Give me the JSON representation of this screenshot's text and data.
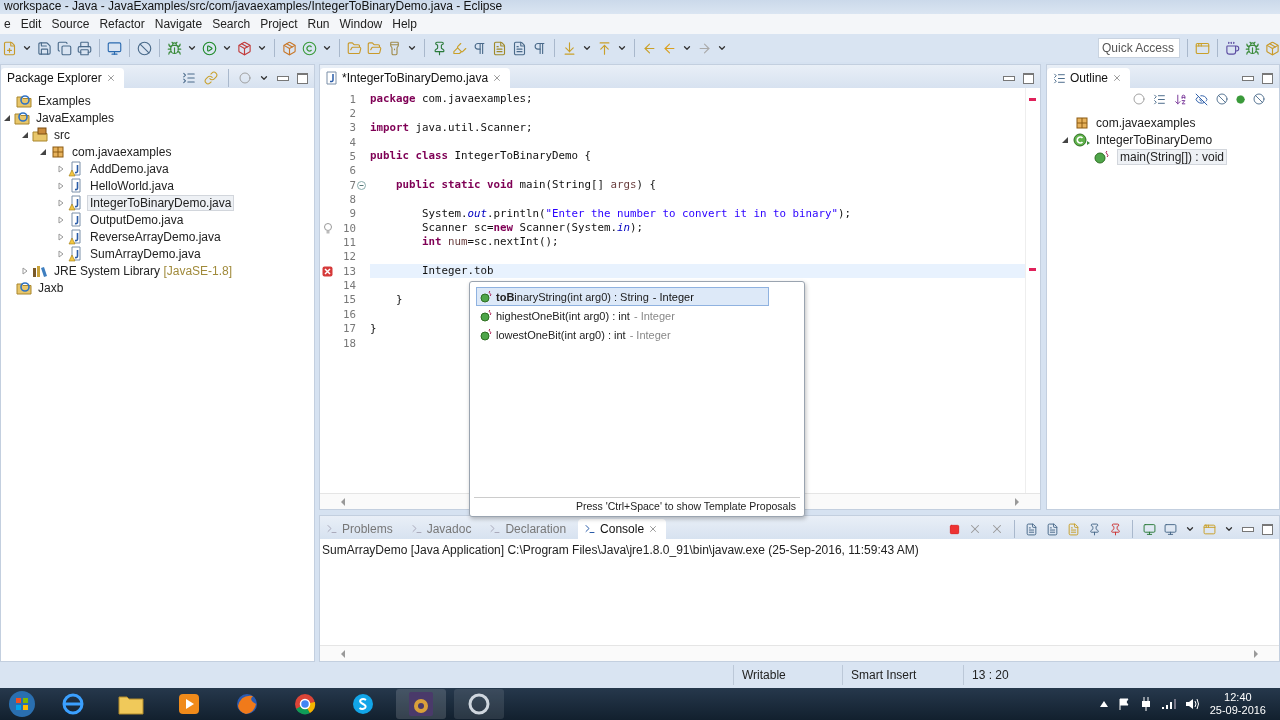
{
  "window": {
    "title": "workspace - Java - JavaExamples/src/com/javaexamples/IntegerToBinaryDemo.java - Eclipse"
  },
  "menu": [
    "e",
    "Edit",
    "Source",
    "Refactor",
    "Navigate",
    "Search",
    "Project",
    "Run",
    "Window",
    "Help"
  ],
  "quick_access": {
    "placeholder": "Quick Access"
  },
  "package_explorer": {
    "title": "Package Explorer",
    "tree": [
      {
        "kind": "project",
        "label": "Examples",
        "selected": false
      },
      {
        "kind": "project",
        "label": "JavaExamples",
        "selected": false,
        "expanded": true,
        "children": [
          {
            "kind": "source",
            "label": "src",
            "selected": false,
            "expanded": true,
            "children": [
              {
                "kind": "package",
                "label": "com.javaexamples",
                "selected": false,
                "expanded": true,
                "children": [
                  {
                    "kind": "java",
                    "label": "AddDemo.java",
                    "selected": false,
                    "expanded": false,
                    "warning": true
                  },
                  {
                    "kind": "java",
                    "label": "HelloWorld.java",
                    "selected": false,
                    "expanded": false,
                    "warning": false
                  },
                  {
                    "kind": "java",
                    "label": "IntegerToBinaryDemo.java",
                    "selected": true,
                    "expanded": false,
                    "warning": true
                  },
                  {
                    "kind": "java",
                    "label": "OutputDemo.java",
                    "selected": false,
                    "expanded": false,
                    "warning": false
                  },
                  {
                    "kind": "java",
                    "label": "ReverseArrayDemo.java",
                    "selected": false,
                    "expanded": false,
                    "warning": true
                  },
                  {
                    "kind": "java",
                    "label": "SumArrayDemo.java",
                    "selected": false,
                    "expanded": false,
                    "warning": true
                  }
                ]
              }
            ]
          },
          {
            "kind": "library",
            "label": "JRE System Library",
            "decoration": "[JavaSE-1.8]",
            "selected": false,
            "expanded": false
          }
        ]
      },
      {
        "kind": "project",
        "label": "Jaxb",
        "selected": false
      }
    ]
  },
  "editor": {
    "tab": {
      "label": "*IntegerToBinaryDemo.java",
      "selected": true
    },
    "lines": [
      {
        "number": "1",
        "kind": "plain",
        "current": false,
        "segments": [
          {
            "kind": "kw",
            "text": "package"
          },
          {
            "kind": "plain",
            "text": " com.javaexamples;"
          }
        ]
      },
      {
        "number": "2",
        "kind": "plain",
        "current": false
      },
      {
        "number": "3",
        "kind": "plain",
        "current": false,
        "segments": [
          {
            "kind": "kw",
            "text": "import"
          },
          {
            "kind": "plain",
            "text": " java.util.Scanner;"
          }
        ]
      },
      {
        "number": "4",
        "kind": "plain",
        "current": false
      },
      {
        "number": "5",
        "kind": "plain",
        "current": false,
        "segments": [
          {
            "kind": "kw",
            "text": "public class"
          },
          {
            "kind": "plain",
            "text": " IntegerToBinaryDemo {"
          }
        ]
      },
      {
        "number": "6",
        "kind": "plain",
        "current": false
      },
      {
        "number": "7",
        "kind": "fold",
        "current": false,
        "segments": [
          {
            "kind": "kw",
            "text": "    public static void"
          },
          {
            "kind": "plain",
            "text": " main(String[] "
          },
          {
            "kind": "local",
            "text": "args"
          },
          {
            "kind": "plain",
            "text": ") {"
          }
        ]
      },
      {
        "number": "8",
        "kind": "plain",
        "current": false
      },
      {
        "number": "9",
        "kind": "plain",
        "current": false,
        "segments": [
          {
            "kind": "plain",
            "text": "        System."
          },
          {
            "kind": "field",
            "text": "out"
          },
          {
            "kind": "plain",
            "text": ".println("
          },
          {
            "kind": "str",
            "text": "\"Enter the number to convert it in to binary\""
          },
          {
            "kind": "plain",
            "text": ");"
          }
        ]
      },
      {
        "number": "10",
        "kind": "warning",
        "current": false,
        "segments": [
          {
            "kind": "plain",
            "text": "        Scanner sc="
          },
          {
            "kind": "kw",
            "text": "new"
          },
          {
            "kind": "plain",
            "text": " Scanner(System."
          },
          {
            "kind": "field",
            "text": "in"
          },
          {
            "kind": "plain",
            "text": ");"
          }
        ]
      },
      {
        "number": "11",
        "kind": "plain",
        "current": false,
        "segments": [
          {
            "kind": "kw",
            "text": "        int "
          },
          {
            "kind": "local",
            "text": "num"
          },
          {
            "kind": "plain",
            "text": "=sc.nextInt();"
          }
        ]
      },
      {
        "number": "12",
        "kind": "plain",
        "current": false
      },
      {
        "number": "13",
        "kind": "error",
        "current": true,
        "segments": [
          {
            "kind": "plain",
            "text": "        Integer.tob"
          }
        ]
      },
      {
        "number": "14",
        "kind": "plain",
        "current": false
      },
      {
        "number": "15",
        "kind": "plain",
        "current": false,
        "segments": [
          {
            "kind": "plain",
            "text": "    }"
          }
        ]
      },
      {
        "number": "16",
        "kind": "plain",
        "current": false
      },
      {
        "number": "17",
        "kind": "plain",
        "current": false,
        "segments": [
          {
            "kind": "plain",
            "text": "}"
          }
        ]
      },
      {
        "number": "18",
        "kind": "plain",
        "current": false
      }
    ],
    "completion": {
      "items": [
        {
          "label": "**toB**inaryString(int arg0) : String",
          "owner": "- Integer",
          "selected": true
        },
        {
          "label": "highestOneBit(int arg0) : int",
          "owner": "- Integer",
          "selected": false
        },
        {
          "label": "lowestOneBit(int arg0) : int",
          "owner": "- Integer",
          "selected": false
        }
      ],
      "footer": "Press 'Ctrl+Space' to show Template Proposals"
    }
  },
  "outline": {
    "title": "Outline",
    "tree": [
      {
        "kind": "package",
        "label": "com.javaexamples",
        "selected": false
      },
      {
        "kind": "class",
        "label": "IntegerToBinaryDemo",
        "selected": false,
        "expanded": true,
        "children": [
          {
            "kind": "method",
            "label": "main(String[]) : void",
            "selected": true
          }
        ]
      }
    ]
  },
  "console": {
    "tabs": [
      {
        "label": "Problems",
        "selected": false
      },
      {
        "label": "Javadoc",
        "selected": false
      },
      {
        "label": "Declaration",
        "selected": false
      },
      {
        "label": "Console",
        "selected": true
      }
    ],
    "text": "SumArrayDemo [Java Application] C:\\Program Files\\Java\\jre1.8.0_91\\bin\\javaw.exe (25-Sep-2016, 11:59:43 AM)"
  },
  "status_bar": [
    "Writable",
    "Smart Insert",
    "13 : 20"
  ],
  "taskbar": {
    "time": "12:40",
    "date": "25-09-2016"
  }
}
